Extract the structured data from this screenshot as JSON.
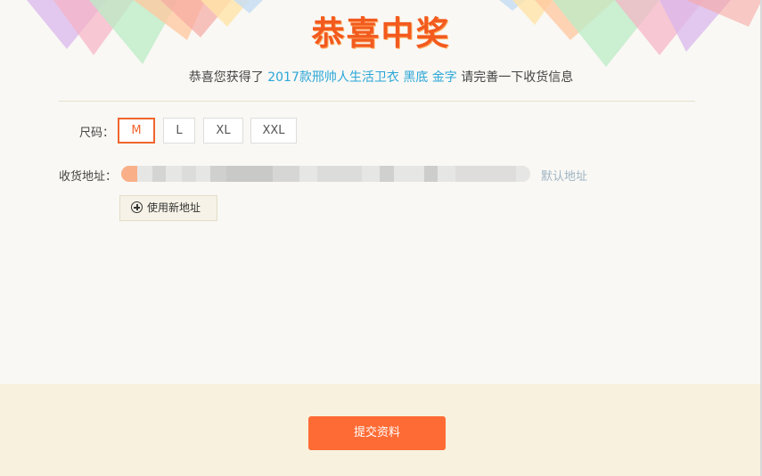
{
  "header": {
    "title": "恭喜中奖",
    "subtitle_prefix": "恭喜您获得了",
    "prize_name": "2017款邢帅人生活卫衣 黑底 金字",
    "subtitle_suffix": "请完善一下收货信息"
  },
  "size": {
    "label": "尺码：",
    "options": [
      "M",
      "L",
      "XL",
      "XXL"
    ],
    "selected": "M"
  },
  "address": {
    "label": "收货地址：",
    "value_redacted": true,
    "default_label": "默认地址",
    "add_new_label": "使用新地址"
  },
  "footer": {
    "submit_label": "提交资料"
  },
  "colors": {
    "accent": "#ff6b35",
    "title": "#f25a1e",
    "prize_text": "#2ba6d8",
    "footer_bg": "#f8f1dd",
    "page_bg": "#f9f8f4"
  },
  "icons": {
    "add_address": "plus-circle-icon"
  }
}
